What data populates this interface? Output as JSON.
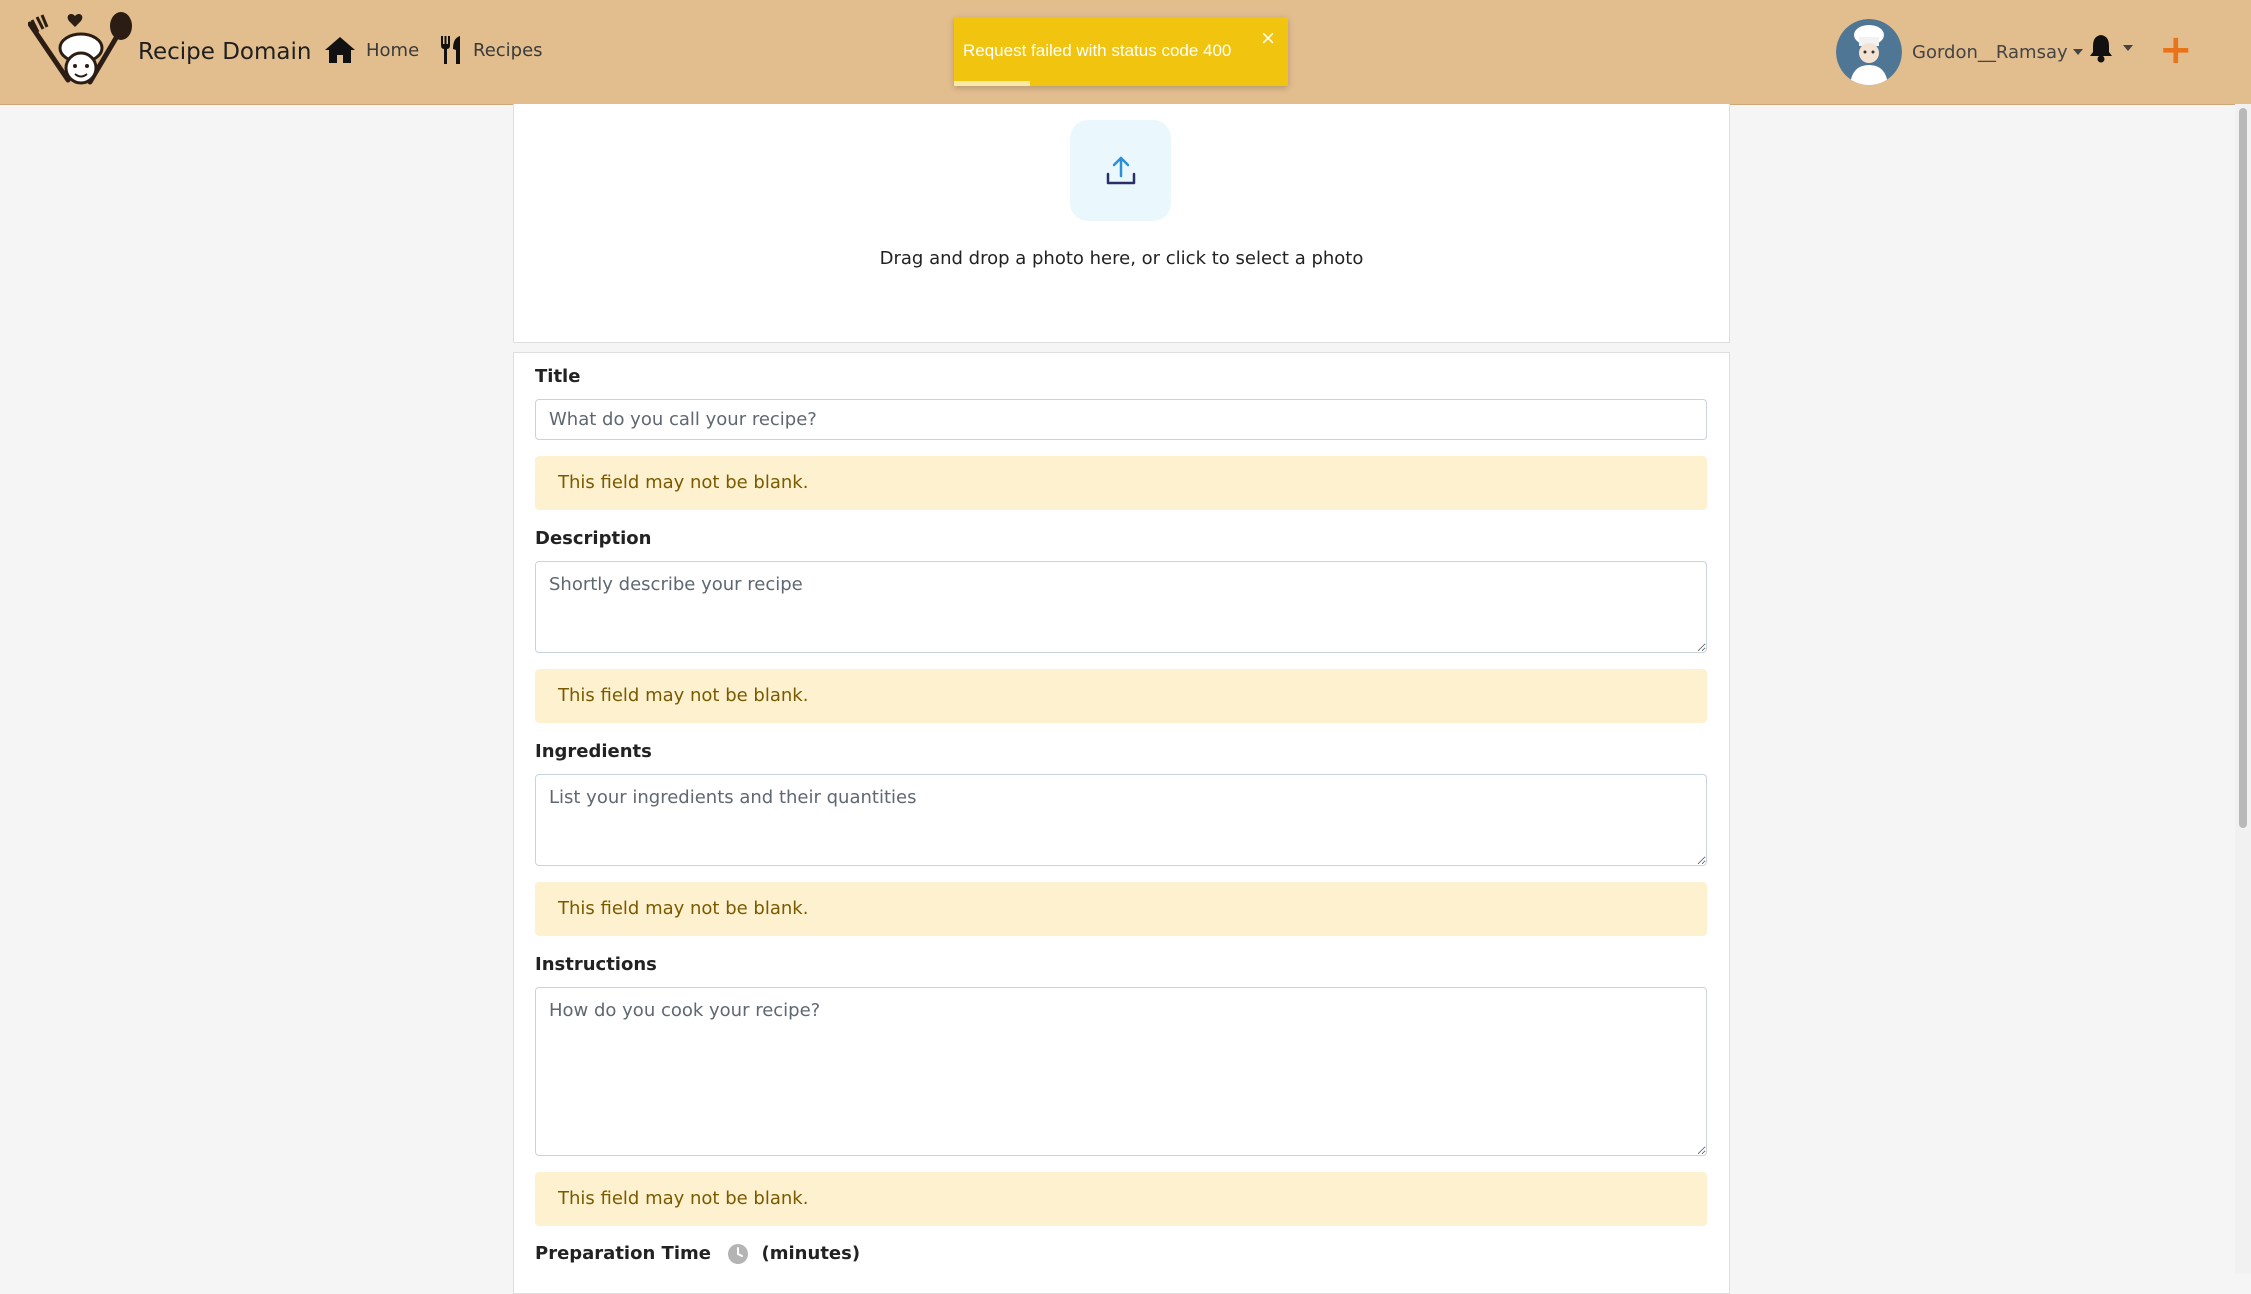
{
  "nav": {
    "brand": "Recipe Domain",
    "links": [
      {
        "label": "Home"
      },
      {
        "label": "Recipes"
      }
    ],
    "user": {
      "name": "Gordon__Ramsay"
    }
  },
  "toast": {
    "message": "Request failed with status code 400",
    "close": "×",
    "color": "#f1c40f"
  },
  "upload": {
    "text": "Drag and drop a photo here, or click to select a photo"
  },
  "form": {
    "title": {
      "label": "Title",
      "placeholder": "What do you call your recipe?",
      "error": "This field may not be blank."
    },
    "description": {
      "label": "Description",
      "placeholder": "Shortly describe your recipe",
      "error": "This field may not be blank."
    },
    "ingredients": {
      "label": "Ingredients",
      "placeholder": "List your ingredients and their quantities",
      "error": "This field may not be blank."
    },
    "instructions": {
      "label": "Instructions",
      "placeholder": "How do you cook your recipe?",
      "error": "This field may not be blank."
    },
    "prep_time": {
      "label": "Preparation Time",
      "unit": "(minutes)"
    }
  },
  "colors": {
    "navbar": "#e2bd8e",
    "accent": "#e8731a",
    "alert_bg": "#fdf1cf",
    "alert_text": "#7a5a00"
  },
  "icons": [
    "chef-logo-icon",
    "home-icon",
    "utensils-icon",
    "bell-icon",
    "plus-icon",
    "upload-icon",
    "clock-icon"
  ]
}
